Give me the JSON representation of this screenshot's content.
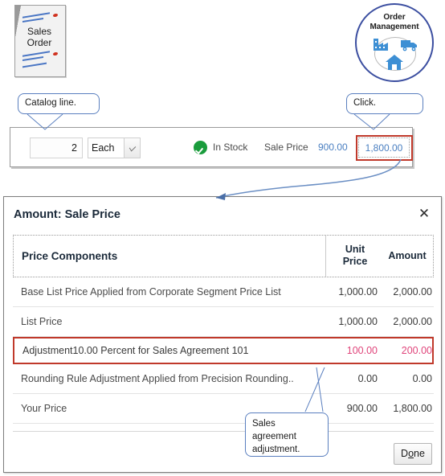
{
  "illustration": {
    "sales_order_doc": {
      "label_line1": "Sales",
      "label_line2": "Order",
      "icon": "sales-order-document-icon"
    },
    "order_management_badge": {
      "title_line1": "Order",
      "title_line2": "Management",
      "icons": [
        "factory-icon",
        "truck-icon",
        "house-icon"
      ],
      "accent_color": "#3b4ea0",
      "icon_color": "#3d8fd4"
    }
  },
  "callouts": {
    "catalog_line": "Catalog line.",
    "click": "Click.",
    "sales_agreement": "Sales agreement adjustment.",
    "border_color": "#5a7fbf"
  },
  "order_line": {
    "quantity": "2",
    "uom": "Each",
    "uom_dropdown_icon": "chevron-down-icon",
    "availability_icon": "check-circle-icon",
    "availability": "In Stock",
    "sale_price_label": "Sale Price",
    "sale_price_value": "900.00",
    "extended_amount": "1,800.00",
    "highlight_color": "#c0392b",
    "link_color": "#4a7fc1"
  },
  "dialog": {
    "title": "Amount: Sale Price",
    "close_icon": "close-icon",
    "columns": [
      "Price Components",
      "Unit Price",
      "Amount"
    ],
    "column_unit_price_line1": "Unit",
    "column_unit_price_line2": "Price",
    "rows": [
      {
        "name": "Base List Price Applied from Corporate Segment Price List",
        "unit_price": "1,000.00",
        "amount": "2,000.00",
        "highlighted": false
      },
      {
        "name": "List Price",
        "unit_price": "1,000.00",
        "amount": "2,000.00",
        "highlighted": false
      },
      {
        "name": "Adjustment10.00 Percent for Sales Agreement 101",
        "unit_price": "100.00",
        "amount": "200.00",
        "highlighted": true
      },
      {
        "name": "Rounding Rule Adjustment Applied from Precision Rounding..",
        "unit_price": "0.00",
        "amount": "0.00",
        "highlighted": false
      },
      {
        "name": "Your Price",
        "unit_price": "900.00",
        "amount": "1,800.00",
        "highlighted": false
      }
    ],
    "done_button_prefix": "D",
    "done_button_mnemonic": "o",
    "done_button_suffix": "ne",
    "highlight_row_color": "#c0392b",
    "highlight_value_color": "#e0457b"
  }
}
